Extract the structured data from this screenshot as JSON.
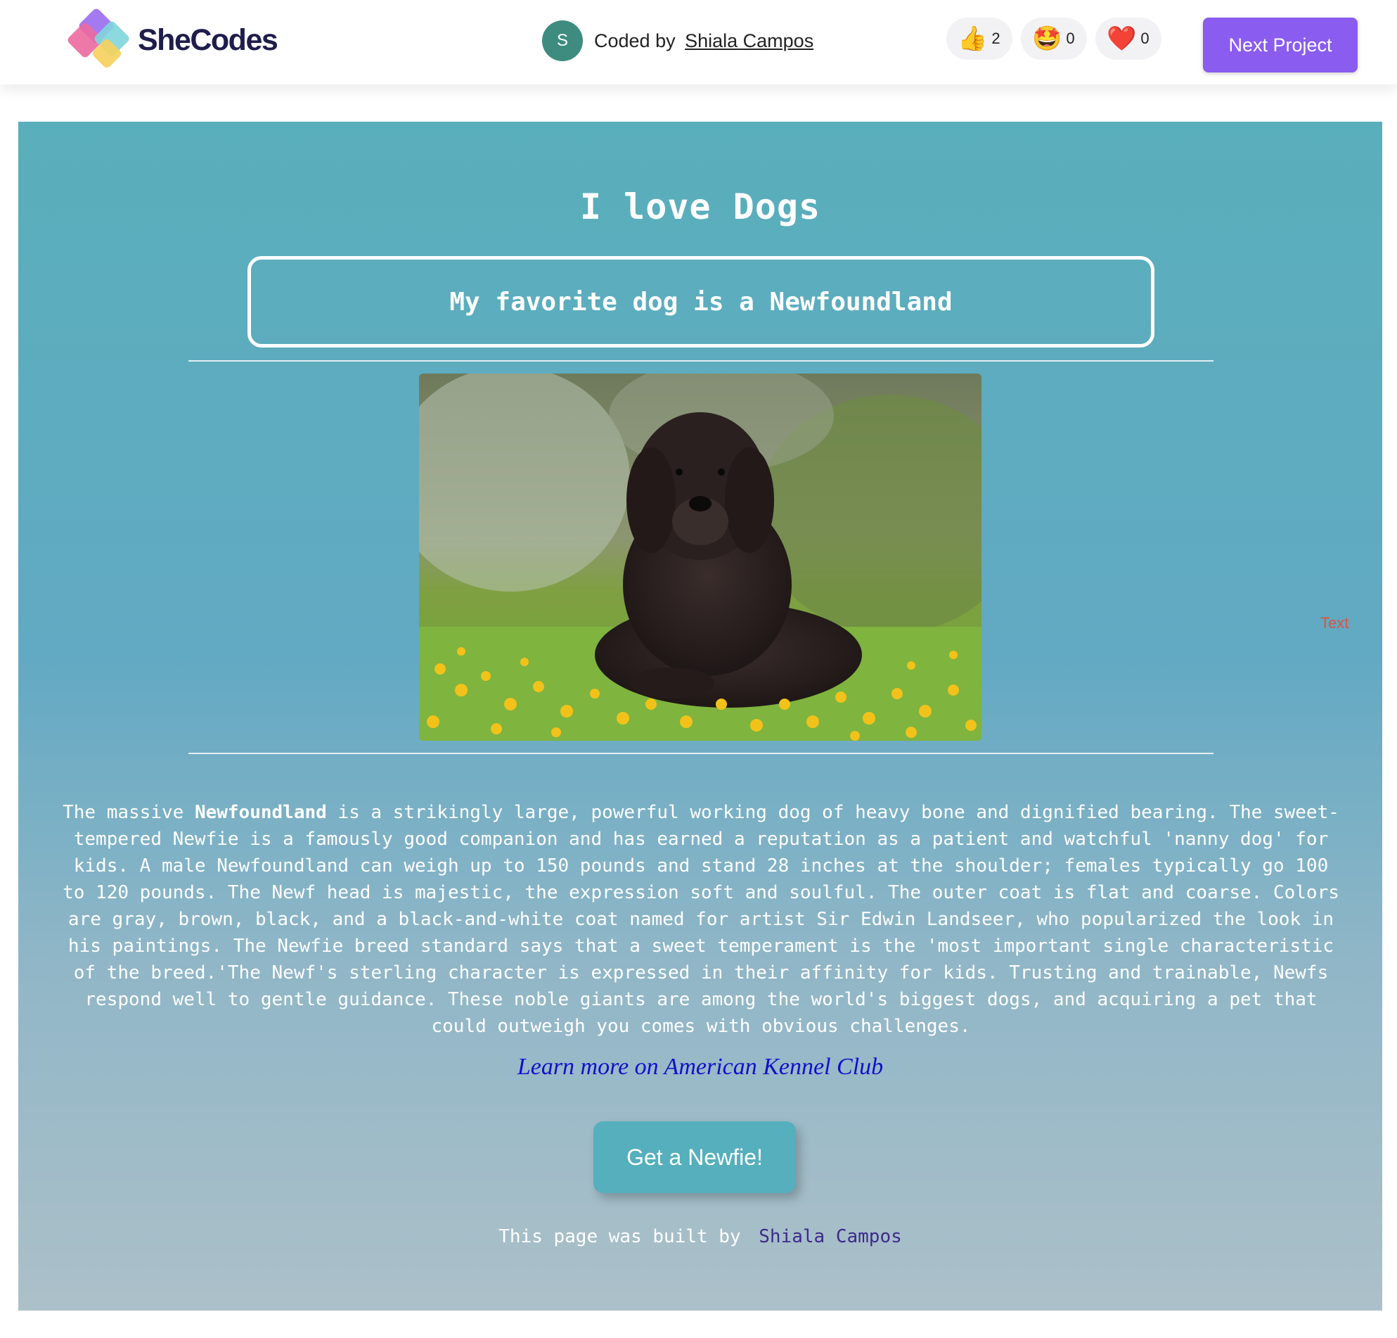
{
  "topbar": {
    "logo_text": "SheCodes",
    "avatar_initial": "S",
    "coded_by_label": "Coded by",
    "author_name": "Shiala Campos",
    "reactions": [
      {
        "icon": "thumbs-up-icon",
        "emoji": "👍",
        "count": "2"
      },
      {
        "icon": "star-struck-icon",
        "emoji": "🤩",
        "count": "0"
      },
      {
        "icon": "heart-icon",
        "emoji": "❤️",
        "count": "0"
      }
    ],
    "next_project_label": "Next Project"
  },
  "project": {
    "title": "I love Dogs",
    "subtitle": "My favorite dog is a Newfoundland",
    "image_icon": "newfoundland-dog-photo",
    "stray_text": "Text",
    "description": {
      "intro": "The massive",
      "breed_bold": "Newfoundland",
      "body": "is a strikingly large, powerful working dog of heavy bone and dignified bearing. The sweet-tempered Newfie is a famously good companion and has earned a reputation as a patient and watchful 'nanny dog' for kids. A male Newfoundland can weigh up to 150 pounds and stand 28 inches at the shoulder; females typically go 100 to 120 pounds. The Newf head is majestic, the expression soft and soulful. The outer coat is flat and coarse. Colors are gray, brown, black, and a black-and-white coat named for artist Sir Edwin Landseer, who popularized the look in his paintings. The Newfie breed standard says that a sweet temperament is the 'most important single characteristic of the breed.'The Newf's sterling character is expressed in their affinity for kids. Trusting and trainable, Newfs respond well to gentle guidance. These noble giants are among the world's biggest dogs, and acquiring a pet that could outweigh you comes with obvious challenges."
    },
    "akc_link_label": "Learn more on American Kennel Club",
    "cta_label": "Get a Newfie!",
    "footer_label": "This page was built by",
    "footer_author": "Shiala Campos"
  },
  "colors": {
    "accent_purple": "#8a5cf0",
    "cta_teal": "#55afbc",
    "link_blue": "#1010cc",
    "gradient_top": "#59afbb",
    "gradient_bottom": "#acc0c9"
  }
}
